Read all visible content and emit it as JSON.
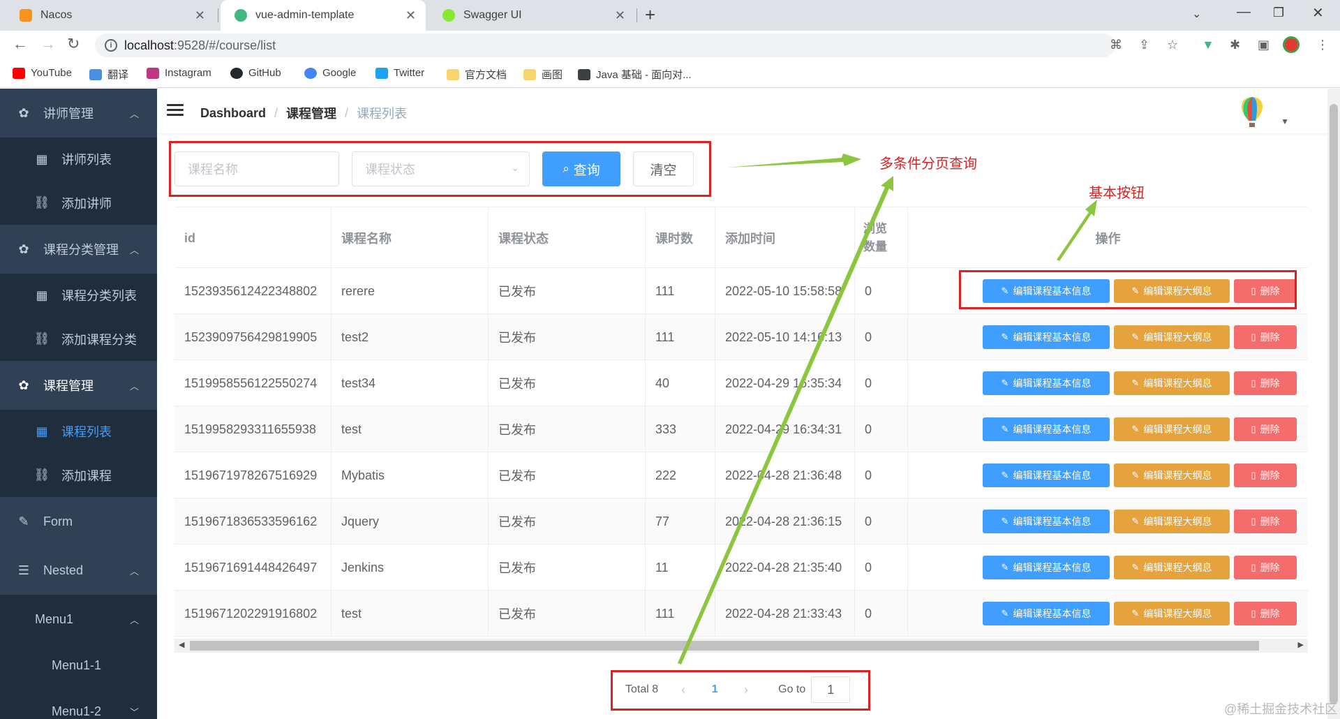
{
  "browser": {
    "tabs": [
      {
        "title": "Nacos",
        "favicon_color": "#f7931e"
      },
      {
        "title": "vue-admin-template",
        "favicon_color": "#41b883"
      },
      {
        "title": "Swagger UI",
        "favicon_color": "#85ea2d"
      }
    ],
    "url_host": "localhost",
    "url_rest": ":9528/#/course/list",
    "bookmarks": [
      {
        "label": "YouTube",
        "icon_color": "#ff0000"
      },
      {
        "label": "翻译",
        "icon_color": "#4a90e2"
      },
      {
        "label": "Instagram",
        "icon_color": "#c13584"
      },
      {
        "label": "GitHub",
        "icon_color": "#24292e"
      },
      {
        "label": "Google",
        "icon_color": "#4285f4"
      },
      {
        "label": "Twitter",
        "icon_color": "#1da1f2"
      },
      {
        "label": "官方文档",
        "icon_color": "#f9d56e"
      },
      {
        "label": "画图",
        "icon_color": "#f9d56e"
      },
      {
        "label": "Java 基础 - 面向对...",
        "icon_color": "#3c4043"
      }
    ]
  },
  "sidebar": {
    "items": [
      {
        "label": "讲师管理",
        "icon": "gear-icon",
        "type": "parent"
      },
      {
        "label": "讲师列表",
        "icon": "table-icon",
        "type": "child"
      },
      {
        "label": "添加讲师",
        "icon": "tree-icon",
        "type": "child"
      },
      {
        "label": "课程分类管理",
        "icon": "gear-icon",
        "type": "parent"
      },
      {
        "label": "课程分类列表",
        "icon": "table-icon",
        "type": "child"
      },
      {
        "label": "添加课程分类",
        "icon": "tree-icon",
        "type": "child"
      },
      {
        "label": "课程管理",
        "icon": "gear-icon",
        "type": "parent"
      },
      {
        "label": "课程列表",
        "icon": "table-icon",
        "type": "child",
        "active": true
      },
      {
        "label": "添加课程",
        "icon": "tree-icon",
        "type": "child"
      },
      {
        "label": "Form",
        "icon": "form-icon",
        "type": "parent"
      },
      {
        "label": "Nested",
        "icon": "nested-icon",
        "type": "parent"
      },
      {
        "label": "Menu1",
        "icon": "",
        "type": "child"
      },
      {
        "label": "Menu1-1",
        "icon": "",
        "type": "child"
      },
      {
        "label": "Menu1-2",
        "icon": "",
        "type": "child"
      }
    ]
  },
  "breadcrumb": [
    "Dashboard",
    "课程管理",
    "课程列表"
  ],
  "search": {
    "name_placeholder": "课程名称",
    "status_placeholder": "课程状态",
    "query_label": "查询",
    "clear_label": "清空"
  },
  "table": {
    "columns": [
      "id",
      "课程名称",
      "课程状态",
      "课时数",
      "添加时间",
      "浏览数量",
      "操作"
    ],
    "rows": [
      {
        "id": "1523935612422348802",
        "title": "rerere",
        "status": "已发布",
        "lessons": "111",
        "created": "2022-05-10 15:58:58",
        "views": "0"
      },
      {
        "id": "1523909756429819905",
        "title": "test2",
        "status": "已发布",
        "lessons": "111",
        "created": "2022-05-10 14:16:13",
        "views": "0"
      },
      {
        "id": "1519958556122550274",
        "title": "test34",
        "status": "已发布",
        "lessons": "40",
        "created": "2022-04-29 16:35:34",
        "views": "0"
      },
      {
        "id": "1519958293311655938",
        "title": "test",
        "status": "已发布",
        "lessons": "333",
        "created": "2022-04-29 16:34:31",
        "views": "0"
      },
      {
        "id": "1519671978267516929",
        "title": "Mybatis",
        "status": "已发布",
        "lessons": "222",
        "created": "2022-04-28 21:36:48",
        "views": "0"
      },
      {
        "id": "1519671836533596162",
        "title": "Jquery",
        "status": "已发布",
        "lessons": "77",
        "created": "2022-04-28 21:36:15",
        "views": "0"
      },
      {
        "id": "1519671691448426497",
        "title": "Jenkins",
        "status": "已发布",
        "lessons": "11",
        "created": "2022-04-28 21:35:40",
        "views": "0"
      },
      {
        "id": "1519671202291916802",
        "title": "test",
        "status": "已发布",
        "lessons": "111",
        "created": "2022-04-28 21:33:43",
        "views": "0"
      }
    ],
    "actions": {
      "edit_info": "编辑课程基本信息",
      "edit_outline": "编辑课程大纲息",
      "delete": "删除"
    }
  },
  "pagination": {
    "total_label": "Total 8",
    "current_page": "1",
    "goto_label": "Go to",
    "goto_value": "1"
  },
  "annotations": {
    "search_note": "多条件分页查询",
    "buttons_note": "基本按钮"
  },
  "watermark": "@稀土掘金技术社区",
  "colors": {
    "sidebar_bg": "#304156",
    "sidebar_sub_bg": "#1f2d3d",
    "primary": "#409eff",
    "warning": "#e6a23c",
    "danger": "#f56c6c",
    "annotation_red": "#e02020",
    "arrow_green": "#8cc63f"
  }
}
